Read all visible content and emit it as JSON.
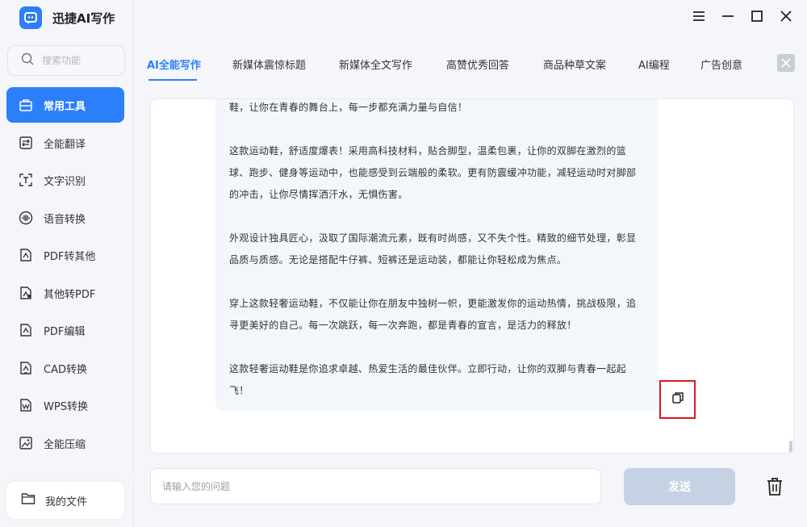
{
  "app": {
    "title": "迅捷AI写作",
    "accent_color": "#2d7ff9",
    "highlight_color": "#e0161b"
  },
  "sidebar": {
    "search_placeholder": "搜索功能",
    "items": [
      {
        "label": "常用工具",
        "icon": "toolbox-icon",
        "active": true
      },
      {
        "label": "全能翻译",
        "icon": "translate-icon"
      },
      {
        "label": "文字识别",
        "icon": "text-recognition-icon"
      },
      {
        "label": "语音转换",
        "icon": "voice-icon"
      },
      {
        "label": "PDF转其他",
        "icon": "pdf-convert-icon"
      },
      {
        "label": "其他转PDF",
        "icon": "to-pdf-icon"
      },
      {
        "label": "PDF编辑",
        "icon": "pdf-edit-icon"
      },
      {
        "label": "CAD转换",
        "icon": "cad-icon"
      },
      {
        "label": "WPS转换",
        "icon": "wps-icon"
      },
      {
        "label": "全能压缩",
        "icon": "compress-icon"
      }
    ],
    "my_files": "我的文件"
  },
  "window_controls": [
    "menu-icon",
    "minimize-icon",
    "maximize-icon",
    "close-icon"
  ],
  "tabs": [
    {
      "label": "AI全能写作",
      "active": true
    },
    {
      "label": "新媒体震惊标题"
    },
    {
      "label": "新媒体全文写作"
    },
    {
      "label": "高赞优秀回答"
    },
    {
      "label": "商品种草文案"
    },
    {
      "label": "AI编程"
    },
    {
      "label": "广告创意"
    }
  ],
  "answer": {
    "paragraphs": [
      "鞋，让你在青春的舞台上，每一步都充满力量与自信！",
      "这款运动鞋，舒适度爆表！采用高科技材料，贴合脚型，温柔包裹，让你的双脚在激烈的篮球、跑步、健身等运动中，也能感受到云端般的柔软。更有防震缓冲功能，减轻运动时对脚部的冲击，让你尽情挥洒汗水，无惧伤害。",
      "外观设计独具匠心，汲取了国际潮流元素，既有时尚感，又不失个性。精致的细节处理，彰显品质与质感。无论是搭配牛仔裤、短裤还是运动装，都能让你轻松成为焦点。",
      "穿上这款轻奢运动鞋，不仅能让你在朋友中独树一帜，更能激发你的运动热情，挑战极限，追寻更美好的自己。每一次跳跃，每一次奔跑，都是青春的宣言，是活力的释放！",
      "这款轻奢运动鞋是你追求卓越、热爱生活的最佳伙伴。立即行动，让你的双脚与青春一起起飞！"
    ]
  },
  "input": {
    "placeholder": "请输入您的问题",
    "value": ""
  },
  "send_label": "发送"
}
